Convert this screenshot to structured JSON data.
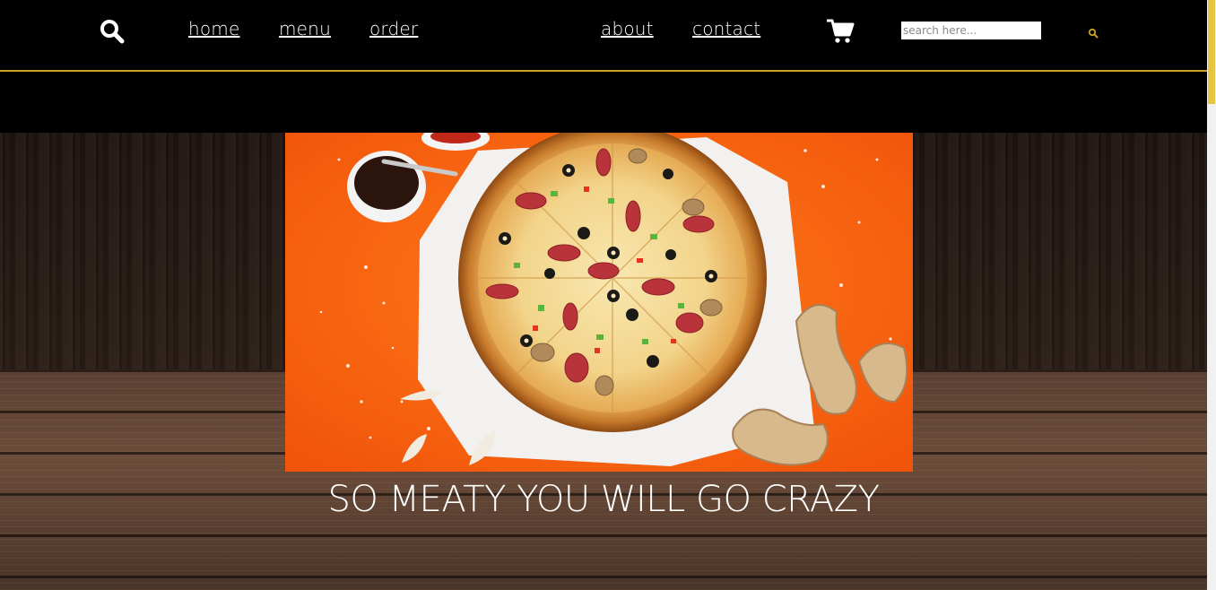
{
  "header": {
    "nav": {
      "home": "home",
      "menu": "menu",
      "order": "order",
      "about": "about",
      "contact": "contact"
    },
    "search": {
      "placeholder": "search here..."
    },
    "accent_color": "#c9a227",
    "icons": [
      "search-icon",
      "cart-icon",
      "search-submit-icon"
    ]
  },
  "hero": {
    "tagline": "SO MEATY YOU WILL GO CRAZY",
    "image": "pizza-photo"
  }
}
